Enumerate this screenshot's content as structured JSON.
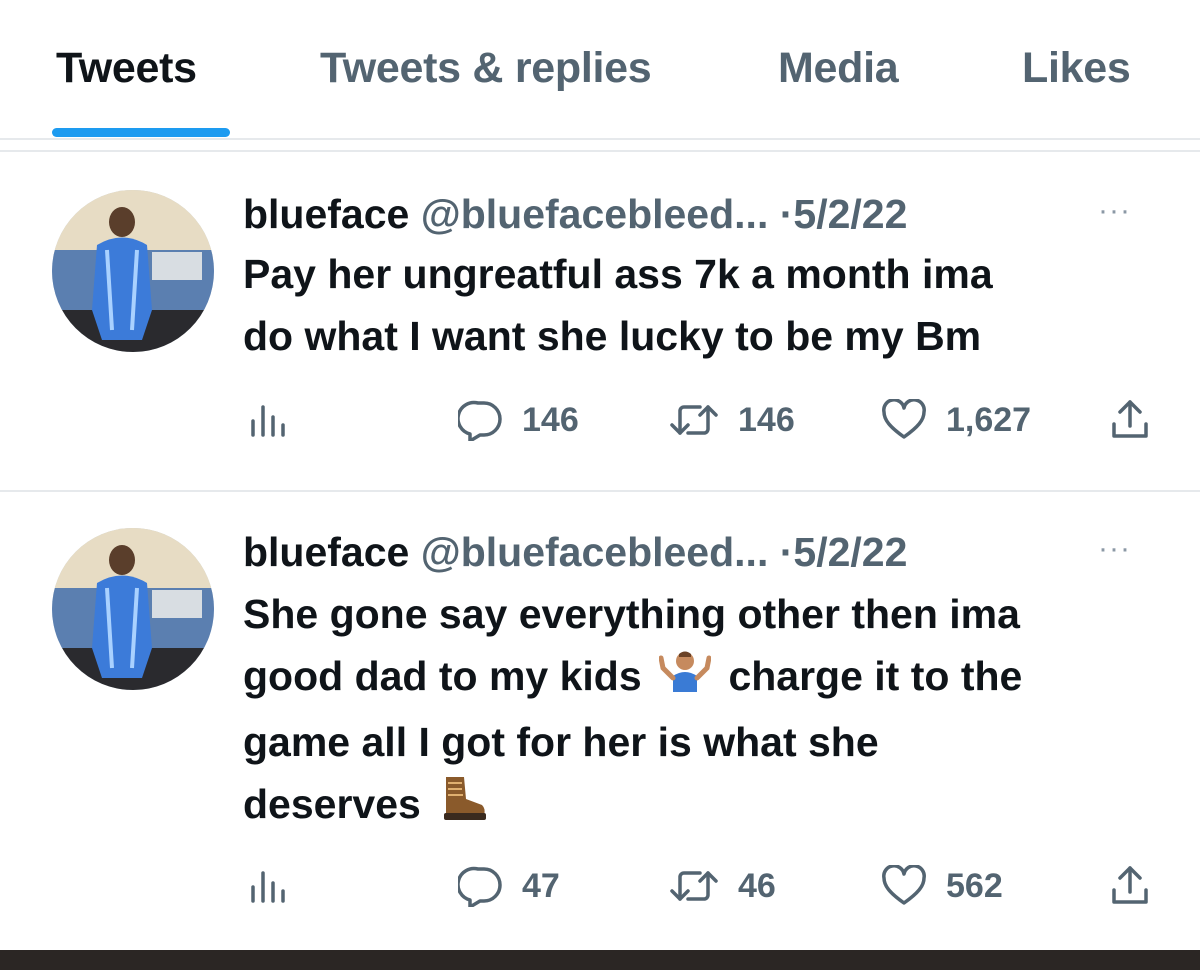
{
  "tabs": [
    {
      "label": "Tweets",
      "active": true
    },
    {
      "label": "Tweets & replies",
      "active": false
    },
    {
      "label": "Media",
      "active": false
    },
    {
      "label": "Likes",
      "active": false
    }
  ],
  "colors": {
    "accent": "#1d9bf0",
    "text": "#0f1419",
    "muted": "#536471"
  },
  "tweets": [
    {
      "name": "blueface",
      "handle": "@bluefacebleed...",
      "separator": "·",
      "date": "5/2/22",
      "more_icon": "···",
      "text_lines": [
        "Pay her ungreatful ass 7k a month ima",
        "do what I want she lucky to be my Bm"
      ],
      "replies": "146",
      "retweets": "146",
      "likes": "1,627"
    },
    {
      "name": "blueface",
      "handle": "@bluefacebleed...",
      "separator": "·",
      "date": "5/2/22",
      "more_icon": "···",
      "text_line1": "She gone say everything other then ima",
      "text_line2a": "good dad to my kids",
      "emoji1": "person-shrugging-emoji",
      "text_line2b": "charge it to the",
      "text_line3": "game all I got for her is what she",
      "text_line4": "deserves",
      "emoji2": "hiking-boot-emoji",
      "replies": "47",
      "retweets": "46",
      "likes": "562"
    }
  ]
}
